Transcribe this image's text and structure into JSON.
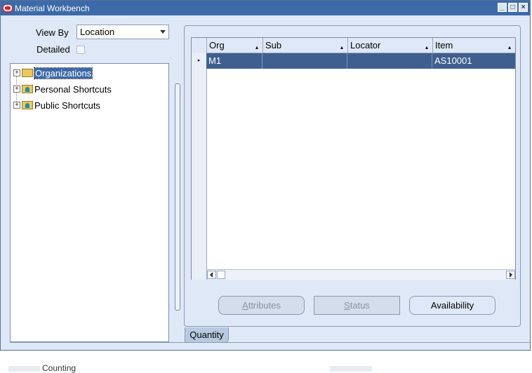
{
  "window": {
    "title": "Material Workbench"
  },
  "form": {
    "view_by_label": "View By",
    "view_by_value": "Location",
    "detailed_label": "Detailed",
    "detailed_checked": false
  },
  "tree": {
    "items": [
      {
        "label": "Organizations",
        "icon": "folder-icon",
        "selected": true
      },
      {
        "label": "Personal Shortcuts",
        "icon": "folder-person-icon",
        "selected": false
      },
      {
        "label": "Public Shortcuts",
        "icon": "folder-person-icon",
        "selected": false
      }
    ]
  },
  "grid": {
    "columns": [
      "Org",
      "Sub",
      "Locator",
      "Item"
    ],
    "rows": [
      {
        "org": "M1",
        "sub": "",
        "locator": "",
        "item": "AS10001"
      }
    ]
  },
  "buttons": {
    "attributes": {
      "prefix": "",
      "mnemonic": "A",
      "rest": "ttributes"
    },
    "status": {
      "prefix": "",
      "mnemonic": "S",
      "rest": "tatus"
    },
    "availability": "Availability"
  },
  "tabs": {
    "quantity": "Quantity"
  },
  "background": {
    "fragment": "Counting"
  }
}
